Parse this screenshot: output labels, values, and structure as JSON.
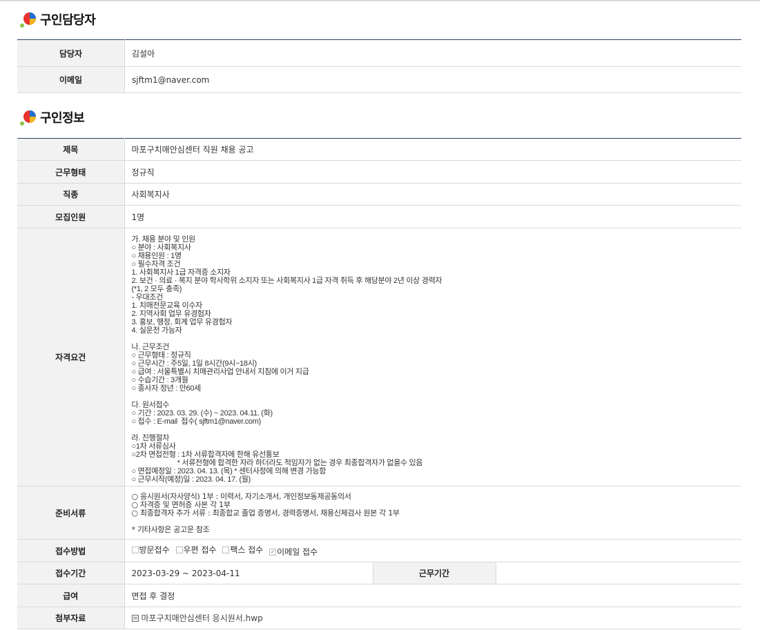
{
  "contact": {
    "title": "구인담당자",
    "rows": [
      {
        "label": "담당자",
        "value": "김설아"
      },
      {
        "label": "이메일",
        "value": "sjftm1@naver.com"
      }
    ]
  },
  "job": {
    "title": "구인정보",
    "subject_label": "제목",
    "subject_value": "마포구치매안심센터 직원 채용 공고",
    "worktype_label": "근무형태",
    "worktype_value": "정규직",
    "occupation_label": "직종",
    "occupation_value": "사회복지사",
    "headcount_label": "모집인원",
    "headcount_value": "1명",
    "requirements_label": "자격요건",
    "requirements_text": "가. 채용 분야 및 인원\n○ 분야 : 사회복지사\n○ 채용인원 : 1명\n○ 필수자격 조건\n1. 사회복지사 1급 자격증 소지자\n2. 보건 · 의료 · 복지 분야 학사학위 소지자 또는 사회복지사 1급 자격 취득 후 해당분야 2년 이상 경력자\n(*1, 2 모두 충족)\n- 우대조건\n1. 치매전문교육 이수자\n2. 지역사회 업무 유경험자\n3. 홍보, 행정, 회계 업무 유경험자\n4. 실운전 가능자\n\n나. 근무조건\n○ 근무형태 : 정규직\n○ 근무시간 : 주5일, 1일 8시간(9시~18시)\n○ 급여 : 서울특별시 치매관리사업 안내서 지침에 이거 지급\n○ 수습기간 : 3개월\n○ 종사자 정년 : 만60세\n\n다. 원서접수\n○ 기간 : 2023. 03. 29. (수) ~ 2023. 04.11. (화)\n○ 접수 : E-mail  접수( sjftm1@naver.com)\n\n라. 진행절차\n○1차 서류심사\n○2차 면접전형 : 1차 서류합격자에 한해 유선통보\n                        * 서류전형에 합격한 자라 하더라도 적임자가 없는 경우 최종합격자가 없을수 있음\n○ 면접예정일 : 2023. 04. 13. (목) * 센터사정에 의해 변경 가능함\n○ 근무시작(예정)일 : 2023. 04. 17. (월)",
    "documents_label": "준비서류",
    "documents_text": "○ 응시원서(자사양식) 1부 : 이력서, 자기소개서, 개인정보동제공동의서\n○ 자격증 및 면허증 사본 각 1부\n○ 최종합격자 추가 서류 : 최종합교 졸업 증명서, 경력증명서, 채용신체검사 원본 각 1부\n\n* 기타사항은 공고문 참조",
    "method_label": "접수방법",
    "methods": [
      {
        "label": "방문접수",
        "checked": false
      },
      {
        "label": "우편 접수",
        "checked": false
      },
      {
        "label": "팩스 접수",
        "checked": false
      },
      {
        "label": "이메일 접수",
        "checked": true
      }
    ],
    "period_label": "접수기간",
    "period_value": "2023-03-29 ~ 2023-04-11",
    "work_period_label": "근무기간",
    "work_period_value": "",
    "salary_label": "급여",
    "salary_value": "면접 후 결정",
    "attachment_label": "첨부자료",
    "attachment_value": "마포구치매안심센터 응시원서.hwp",
    "attachment_icon": "file-icon"
  }
}
